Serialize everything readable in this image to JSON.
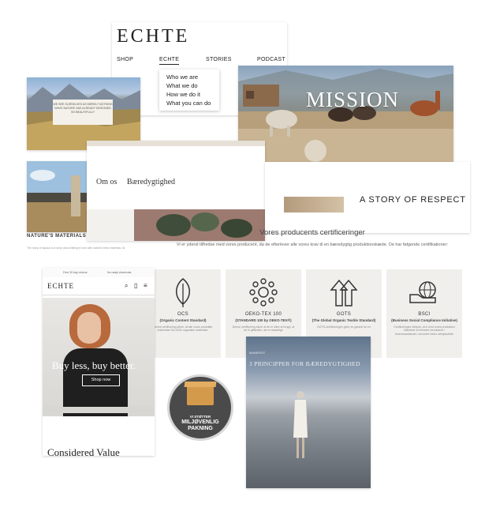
{
  "nav": {
    "logo": "ECHTE",
    "menu": [
      "SHOP",
      "ECHTE",
      "STORIES",
      "PODCAST"
    ],
    "dropdown": [
      "Who we are",
      "What we do",
      "How we do it",
      "What you can do"
    ]
  },
  "mountain_caption": "WE SEE OURSELVES AS MERELY NOTHING WHAT NATURE HAS ALREADY DESIGNED SO BEAUTIFULLY",
  "mission": {
    "title": "MISSION"
  },
  "omos": {
    "items": [
      "Om os",
      "Bæredygtighed"
    ]
  },
  "story": {
    "title": "A STORY OF RESPECT"
  },
  "nature": {
    "heading": "NATURE'S MATERIALS",
    "text": "The story of Alpaca is a story about falling in love with nature's best materials. At"
  },
  "producers": {
    "heading": "Vores producents certificeringer",
    "text": "Vi er yderst tilfredse med vores producent, da de efterlever alle vores krav til en bæredygtig produktionskæde. De har følgende certifikationer:"
  },
  "certs": [
    {
      "icon": "leaf-icon",
      "name": "OCS",
      "sub": "(Organic Content Standard)",
      "desc": "Denne certificering sikrer, at alle vores produkter indeholder 95-100% organiske materialer."
    },
    {
      "icon": "flower-icon",
      "name": "OEKO-TEX 100",
      "sub": "(STANDARD 100 by OEKO-TEX®)",
      "desc": "Denne certificering sikrer at de er sikre at bruge, at de fri giftstoffer, der er skadelige"
    },
    {
      "icon": "recycle-arrows-icon",
      "name": "GOTS",
      "sub": "(The Global Organic Textile Standard)",
      "desc": "GOTS-certificeringen giver en garanti for en"
    },
    {
      "icon": "globe-hand-icon",
      "name": "BSCI",
      "sub": "(Business Social Compliance Initiative)",
      "desc": "Certificeringen belyser, at vi med vores produktion tilstræber at forbedre forholdene i leverandørkæden, herunder bedre arbejdsvilkår"
    }
  ],
  "mobile": {
    "topbar": [
      "Free 30 day returns",
      "No nasty chemicals"
    ],
    "logo": "ECHTE",
    "hero_text": "Buy less, buy better.",
    "shop_label": "Shop now",
    "considered": "Considered Value"
  },
  "badge": {
    "line1": "VI STØTTER",
    "line2": "MILJØVENLIG PAKNING"
  },
  "beach": {
    "tag": "MANIFEST",
    "title": "3 PRINCIPPER FOR BÆREDYGTIGHED"
  }
}
